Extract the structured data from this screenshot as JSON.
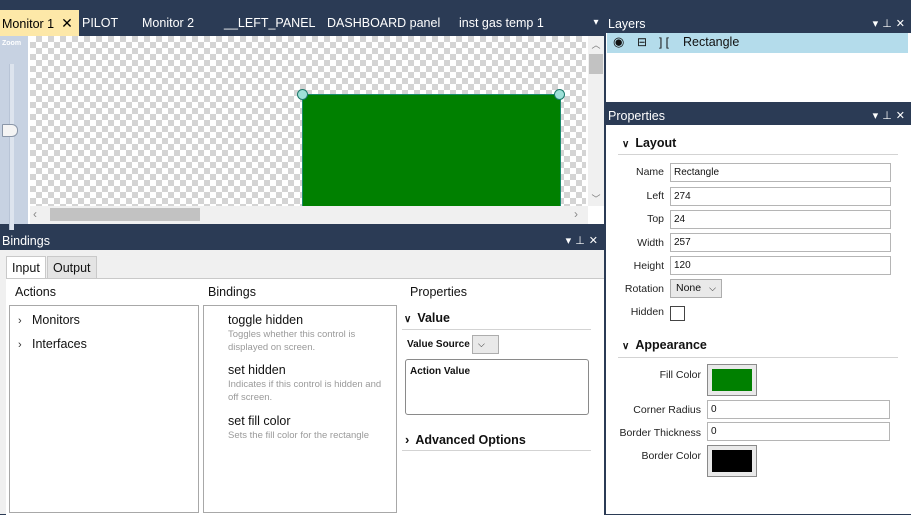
{
  "doc_tabs": [
    {
      "label": "Monitor 1",
      "active": true
    },
    {
      "label": "PILOT",
      "active": false
    },
    {
      "label": "Monitor 2",
      "active": false
    },
    {
      "label": "__LEFT_PANEL",
      "active": false
    },
    {
      "label": "DASHBOARD panel",
      "active": false
    },
    {
      "label": "inst gas temp 1",
      "active": false
    }
  ],
  "canvas": {
    "zoom_label": "Zoom",
    "shape_fill": "#008000",
    "shape_name": "Rectangle"
  },
  "bindings": {
    "title": "Bindings",
    "tabs": [
      "Input",
      "Output"
    ],
    "actions_title": "Actions",
    "actions": [
      "Monitors",
      "Interfaces"
    ],
    "bindings_title": "Bindings",
    "items": [
      {
        "title": "toggle hidden",
        "desc": "Toggles whether this control is displayed on screen."
      },
      {
        "title": "set hidden",
        "desc": "Indicates if this control is hidden and off screen."
      },
      {
        "title": "set fill color",
        "desc": "Sets the fill color for the rectangle"
      }
    ],
    "properties_title": "Properties",
    "value_section": "Value",
    "value_source_label": "Value Source",
    "action_value_label": "Action Value",
    "advanced_section": "Advanced Options"
  },
  "layers": {
    "title": "Layers",
    "rows": [
      {
        "name": "Rectangle"
      }
    ]
  },
  "properties": {
    "title": "Properties",
    "layout_section": "Layout",
    "name_label": "Name",
    "name_value": "Rectangle",
    "left_label": "Left",
    "left_value": "274",
    "top_label": "Top",
    "top_value": "24",
    "width_label": "Width",
    "width_value": "257",
    "height_label": "Height",
    "height_value": "120",
    "rotation_label": "Rotation",
    "rotation_value": "None",
    "hidden_label": "Hidden",
    "hidden_checked": false,
    "appearance_section": "Appearance",
    "fill_color_label": "Fill Color",
    "fill_color": "#008000",
    "corner_radius_label": "Corner Radius",
    "corner_radius_value": "0",
    "border_thickness_label": "Border Thickness",
    "border_thickness_value": "0",
    "border_color_label": "Border Color",
    "border_color": "#000000"
  },
  "colors": {
    "chrome": "#2b3b55",
    "active_tab": "#fde8a8",
    "selection": "#b4dceb"
  }
}
